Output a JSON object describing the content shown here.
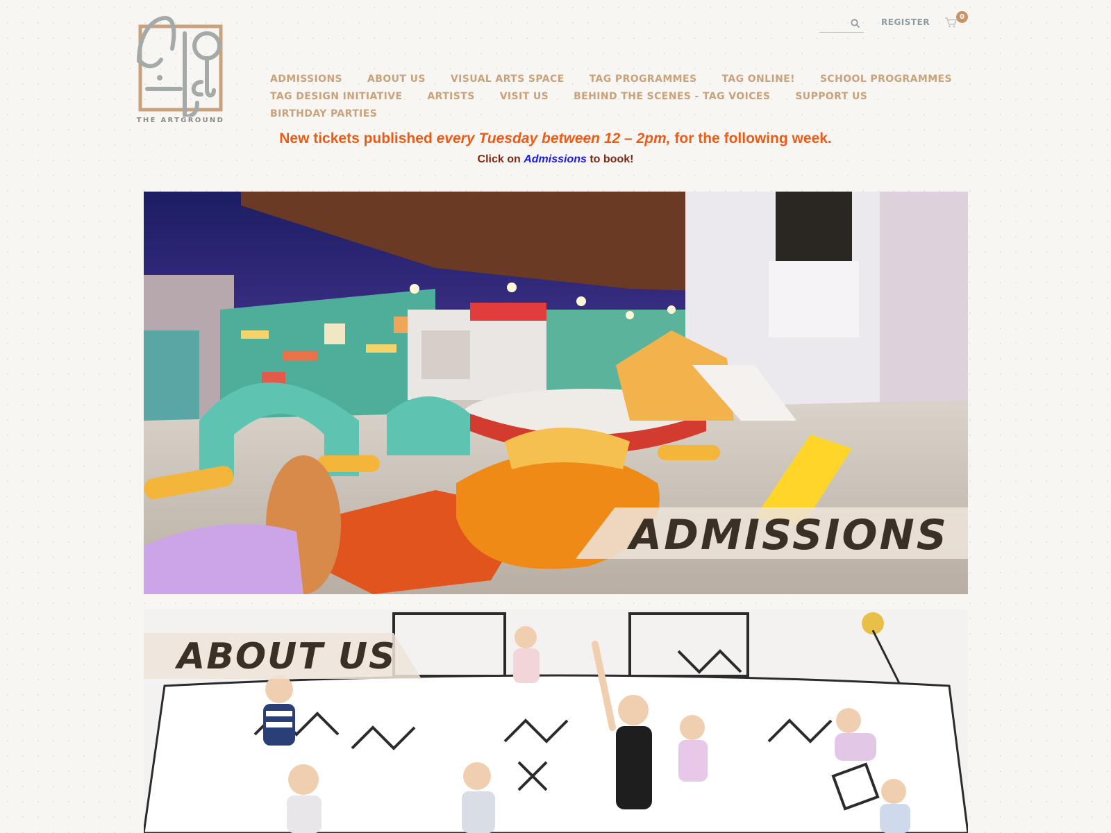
{
  "brand": {
    "logo_caption": "THE ARTGROUND"
  },
  "utility": {
    "search_placeholder": "",
    "register_label": "REGISTER",
    "cart_count": "0"
  },
  "nav": {
    "row1": [
      "ADMISSIONS",
      "ABOUT US",
      "VISUAL ARTS SPACE",
      "TAG PROGRAMMES",
      "TAG ONLINE!",
      "SCHOOL PROGRAMMES"
    ],
    "row2": [
      "TAG DESIGN INITIATIVE",
      "ARTISTS",
      "VISIT US",
      "BEHIND THE SCENES - TAG VOICES",
      "SUPPORT US"
    ],
    "row3": [
      "BIRTHDAY PARTIES"
    ]
  },
  "announcement": {
    "line1_start": "New tickets published ",
    "line1_emphasis": "every Tuesday between 12 – 2pm,",
    "line1_end": " for the following week.",
    "line2_start": "Click on ",
    "line2_link": "Admissions",
    "line2_end": " to book!"
  },
  "banners": {
    "admissions_label": "ADMISSIONS",
    "about_label": "ABOUT US"
  },
  "colors": {
    "nav": "#c9a27c",
    "announcement": "#f05a14",
    "link": "#1a1ae0",
    "register": "#8d9aa0",
    "cart_badge": "#c8956a"
  }
}
